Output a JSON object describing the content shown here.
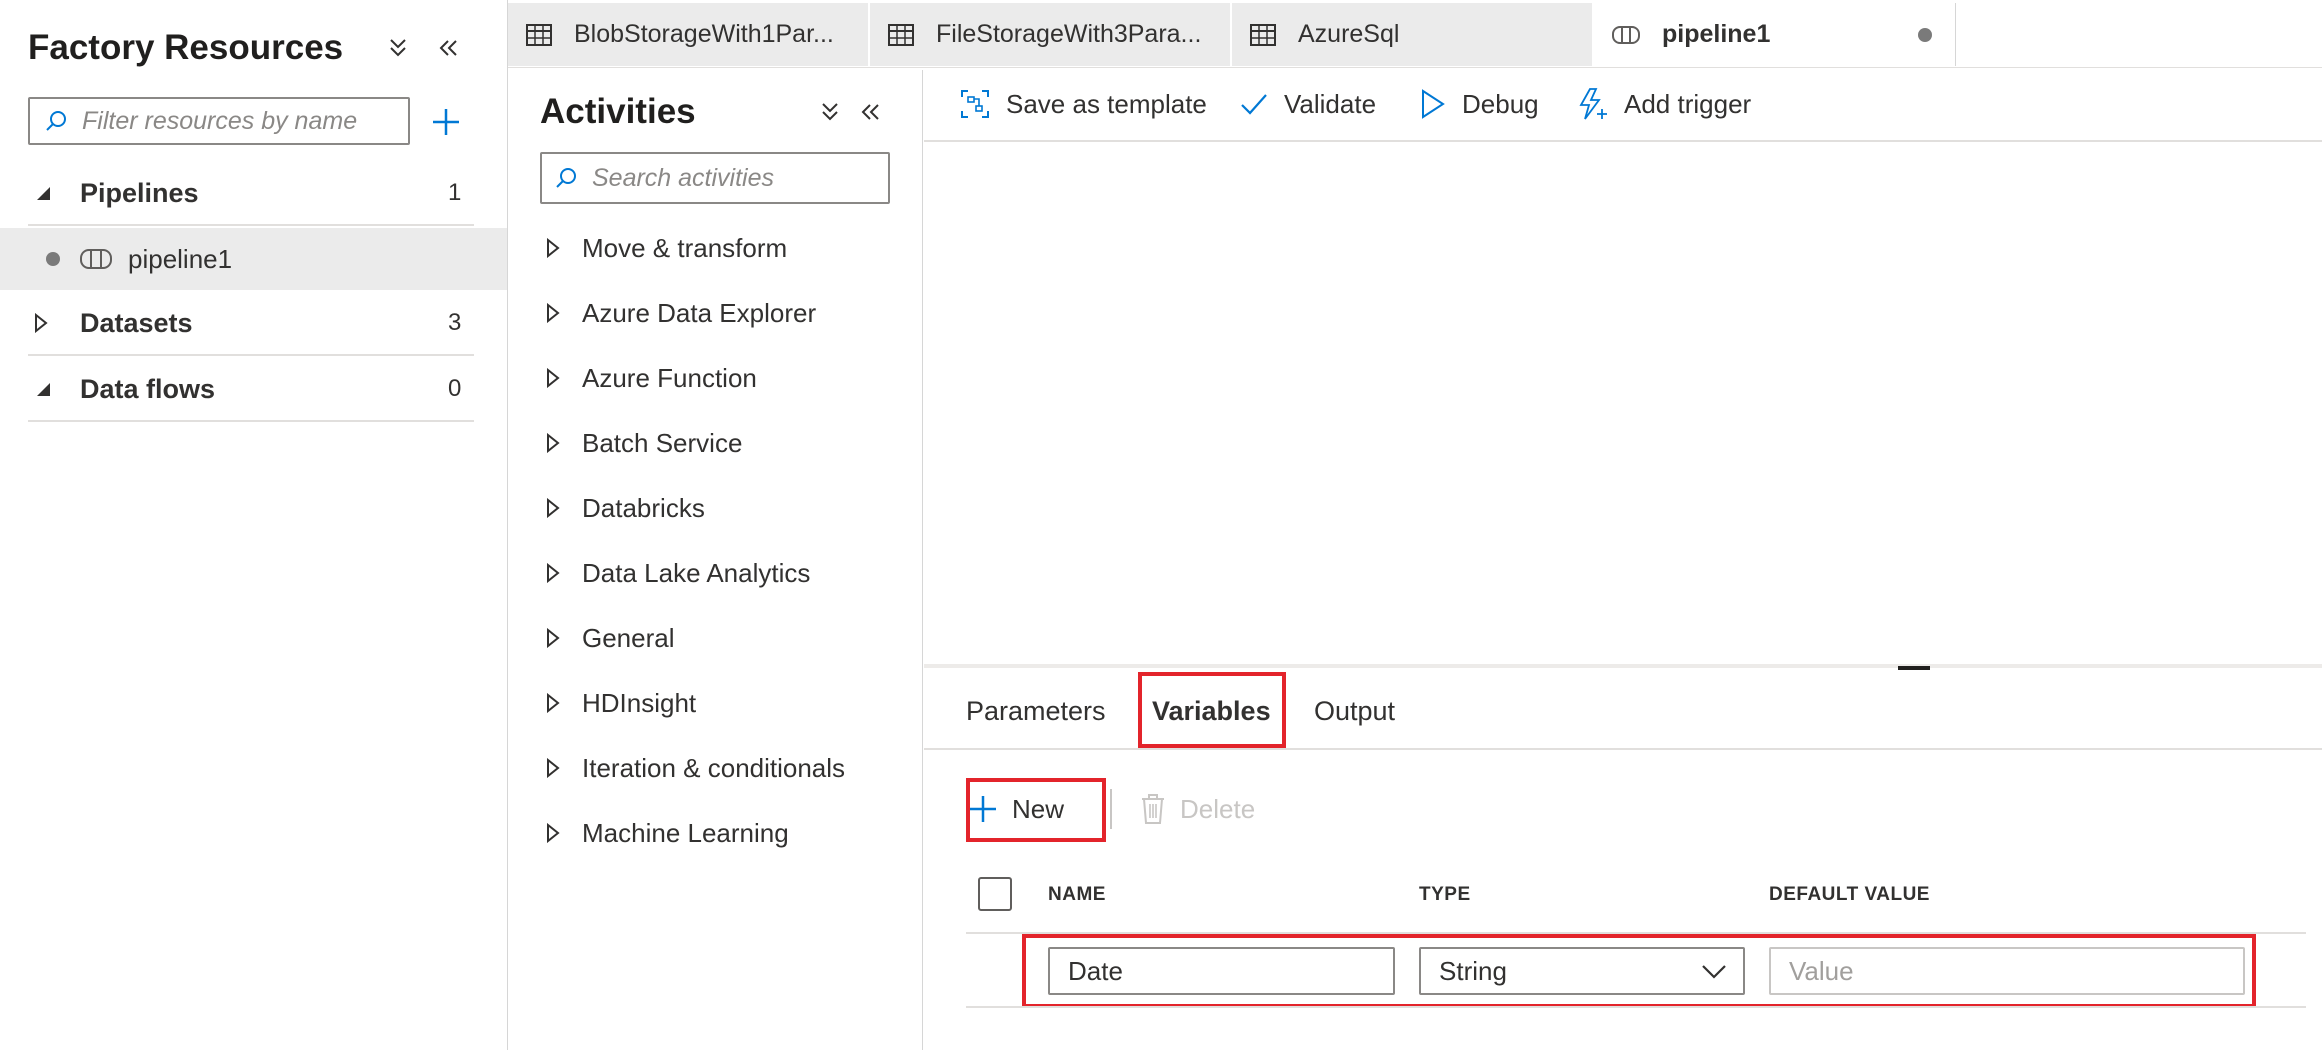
{
  "factory_resources": {
    "title": "Factory Resources",
    "filter_placeholder": "Filter resources by name",
    "tree": [
      {
        "label": "Pipelines",
        "count": "1",
        "expanded": true
      },
      {
        "label": "Datasets",
        "count": "3",
        "expanded": false
      },
      {
        "label": "Data flows",
        "count": "0",
        "expanded": true
      }
    ],
    "pipelines": [
      {
        "label": "pipeline1",
        "unsaved": true
      }
    ]
  },
  "activities": {
    "title": "Activities",
    "search_placeholder": "Search activities",
    "items": [
      "Move & transform",
      "Azure Data Explorer",
      "Azure Function",
      "Batch Service",
      "Databricks",
      "Data Lake Analytics",
      "General",
      "HDInsight",
      "Iteration & conditionals",
      "Machine Learning"
    ]
  },
  "tabs": [
    {
      "label": "BlobStorageWith1Par...",
      "icon": "table-icon"
    },
    {
      "label": "FileStorageWith3Para...",
      "icon": "table-icon"
    },
    {
      "label": "AzureSql",
      "icon": "table-icon"
    },
    {
      "label": "pipeline1",
      "icon": "pipeline-icon",
      "active": true,
      "unsaved": true
    }
  ],
  "toolbar": {
    "save_as_template": "Save as template",
    "validate": "Validate",
    "debug": "Debug",
    "add_trigger": "Add trigger"
  },
  "bottom_panel": {
    "tabs": [
      "Parameters",
      "Variables",
      "Output"
    ],
    "active_tab": "Variables",
    "new_label": "New",
    "delete_label": "Delete",
    "columns": {
      "name": "NAME",
      "type": "TYPE",
      "default_value": "DEFAULT VALUE"
    },
    "variables": [
      {
        "name": "Date",
        "type": "String",
        "default_placeholder": "Value"
      }
    ]
  },
  "colors": {
    "accent": "#0078d4",
    "highlight_box": "#e3242b",
    "selected_bg": "#ebebeb",
    "tab_bg": "#ebebeb"
  }
}
